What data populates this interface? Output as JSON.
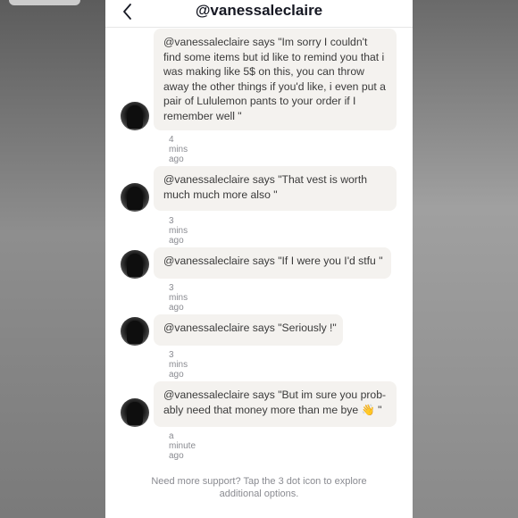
{
  "header": {
    "back_icon": "chevron-left-icon",
    "title": "@vanessaleclaire"
  },
  "messages": [
    {
      "text": "@vanessaleclaire says \"Im sorry I couldn't find some items but id like to remind you that i was making like 5$ on this, you can throw away the other things if you'd like, i even put a pair of Lululemon pants to your order if I remember well \"",
      "time": "4 mins ago"
    },
    {
      "text": "@vanessaleclaire says \"That vest is worth much much more also \"",
      "time": "3 mins ago"
    },
    {
      "text": "@vanessaleclaire says \"If I were you I'd stfu \"",
      "time": "3 mins ago"
    },
    {
      "text": "@vanessaleclaire says \"Seriously !\"",
      "time": "3 mins ago"
    },
    {
      "text": "@vanessaleclaire says \"But im sure you prob-ably need that money more than me bye 👋 \"",
      "time": "a minute ago"
    }
  ],
  "footer": {
    "support_text": "Need more support? Tap the 3 dot icon to explore additional options."
  },
  "colors": {
    "bubble_bg": "#f4f2ef",
    "text": "#3a3a3a",
    "muted": "#8a8b91"
  }
}
